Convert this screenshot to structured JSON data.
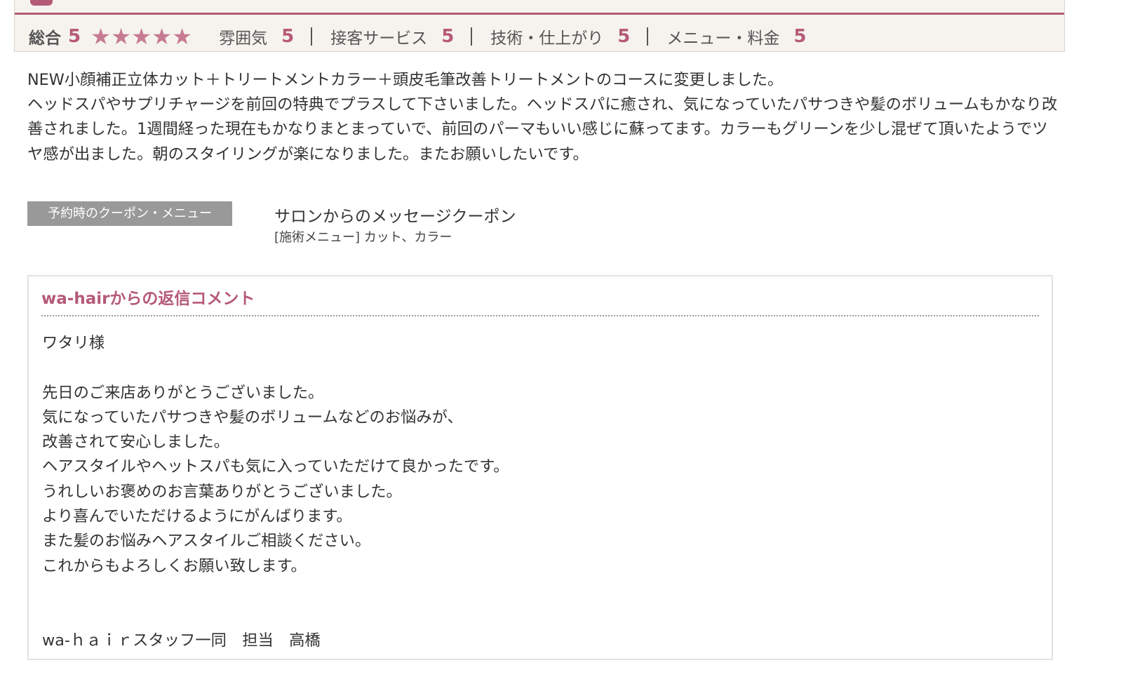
{
  "colors": {
    "accent": "#b55a77",
    "star": "#c67b92",
    "header_bg": "#f6f3ee",
    "badge_bg": "#999999",
    "text": "#333333"
  },
  "rating": {
    "overall_label": "総合",
    "overall_value": "5",
    "star_rating": 5,
    "star_glyph": "★",
    "categories": [
      {
        "label": "雰囲気",
        "value": "5"
      },
      {
        "label": "接客サービス",
        "value": "5"
      },
      {
        "label": "技術・仕上がり",
        "value": "5"
      },
      {
        "label": "メニュー・料金",
        "value": "5"
      }
    ]
  },
  "review": {
    "lines": [
      "NEW小顔補正立体カット＋トリートメントカラー＋頭皮毛筆改善トリートメントのコースに変更しました。",
      "ヘッドスパやサプリチャージを前回の特典でプラスして下さいました。ヘッドスパに癒され、気になっていたパサつきや髪のボリュームもかなり改善されました。1週間経った現在もかなりまとまっていで、前回のパーマもいい感じに蘇ってます。カラーもグリーンを少し混ぜて頂いたようでツヤ感が出ました。朝のスタイリングが楽になりました。またお願いしたいです。"
    ]
  },
  "coupon": {
    "badge_label": "予約時のクーポン・メニュー",
    "name": "サロンからのメッセージクーポン",
    "menu": "[施術メニュー] カット、カラー"
  },
  "reply": {
    "title": "wa-hairからの返信コメント",
    "lines": [
      "ワタリ様",
      "",
      "先日のご来店ありがとうございました。",
      "気になっていたパサつきや髪のボリュームなどのお悩みが、",
      "改善されて安心しました。",
      "ヘアスタイルやヘットスパも気に入っていただけて良かったです。",
      "うれしいお褒めのお言葉ありがとうございました。",
      "より喜んでいただけるようにがんばります。",
      "また髪のお悩みヘアスタイルご相談ください。",
      "これからもよろしくお願い致します。",
      "",
      "",
      "wa-ｈａｉｒスタッフ一同　担当　高橋"
    ]
  }
}
